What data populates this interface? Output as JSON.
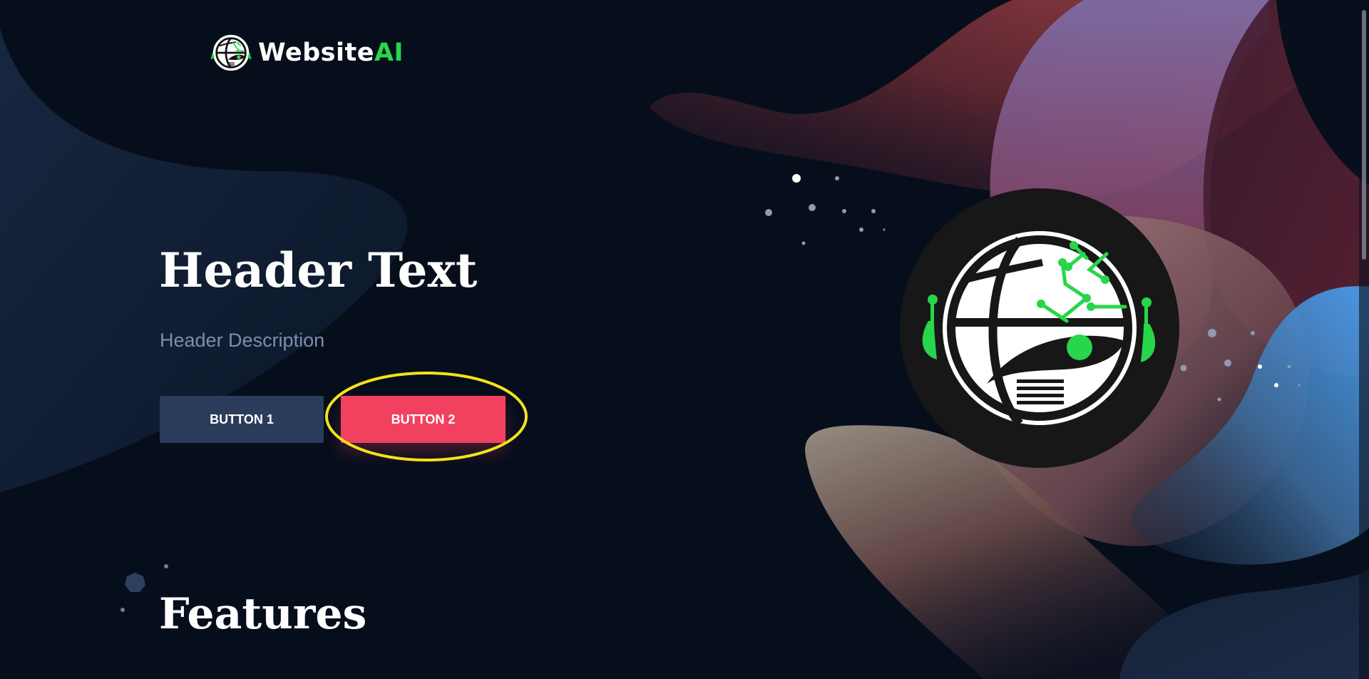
{
  "brand": {
    "name_main": "Website",
    "name_accent": "AI",
    "accent_color": "#27d64a",
    "logo_icon": "globe-circuit-icon"
  },
  "hero": {
    "title": "Header Text",
    "description": "Header Description",
    "button1_label": "BUTTON 1",
    "button2_label": "BUTTON 2",
    "button1_color": "#2b3b5a",
    "button2_color": "#f2415f",
    "highlight_color": "#f3e21a"
  },
  "features": {
    "title": "Features"
  },
  "colors": {
    "background": "#060e1c"
  }
}
